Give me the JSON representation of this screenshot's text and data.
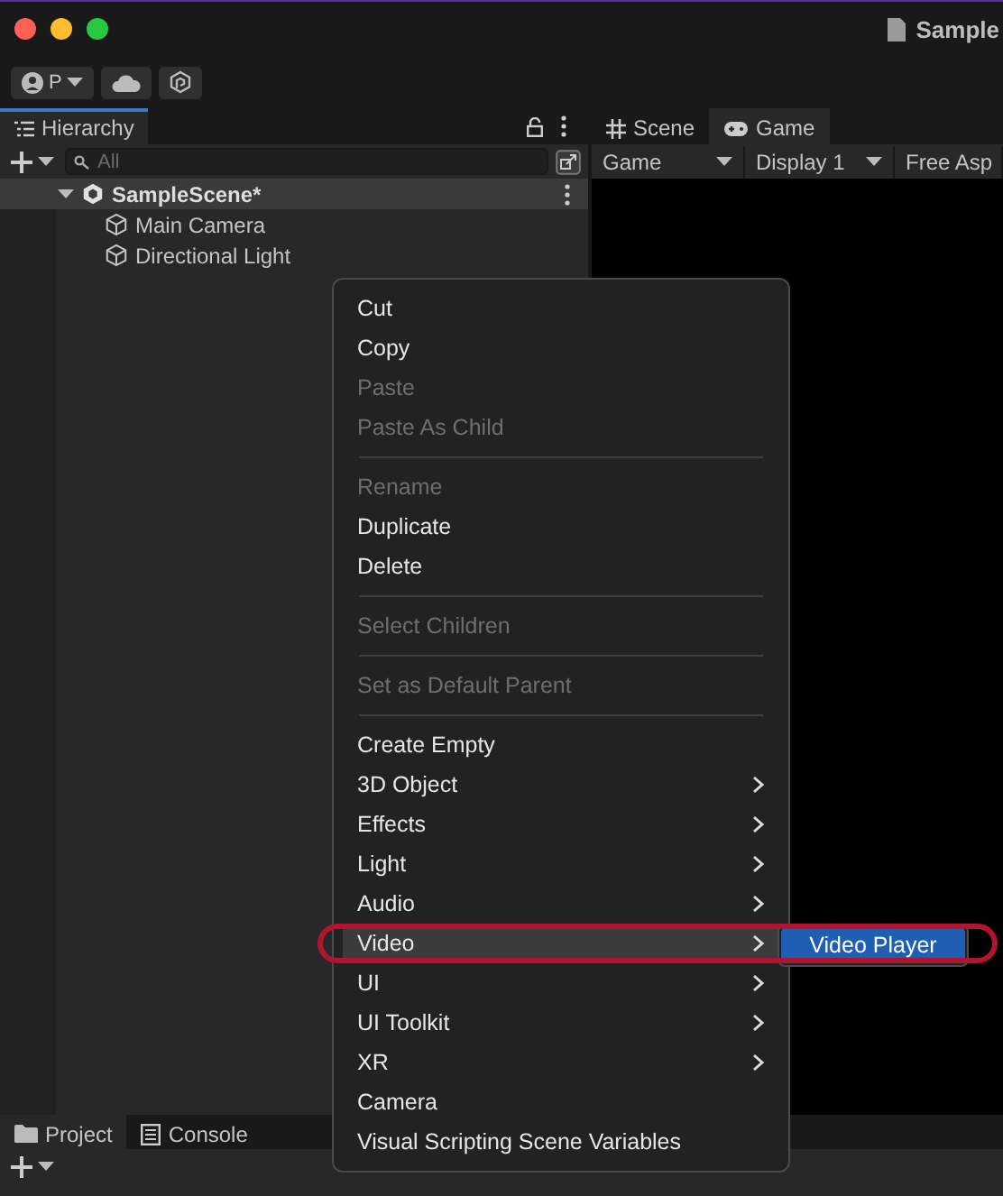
{
  "window": {
    "title": "Sample"
  },
  "toolbar": {
    "account": "P"
  },
  "hierarchy": {
    "tab": "Hierarchy",
    "search": {
      "placeholder": "All"
    },
    "tree": [
      {
        "label": "SampleScene*",
        "kind": "scene",
        "expanded": true,
        "selected": true,
        "children": [
          {
            "label": "Main Camera",
            "kind": "object",
            "selected": false
          },
          {
            "label": "Directional Light",
            "kind": "object",
            "selected": false
          }
        ]
      }
    ]
  },
  "view_tabs": [
    {
      "label": "Scene",
      "kind": "scene",
      "selected": false
    },
    {
      "label": "Game",
      "kind": "game",
      "selected": true
    }
  ],
  "game_toolbar": [
    "Game",
    "Display 1",
    "Free Asp"
  ],
  "bottom_tabs": [
    {
      "label": "Project",
      "kind": "folder",
      "selected": true
    },
    {
      "label": "Console",
      "kind": "console",
      "selected": false
    }
  ],
  "context_menu": {
    "items": [
      {
        "kind": "item",
        "label": "Cut",
        "disabled": false,
        "submenu": false,
        "selected": false
      },
      {
        "kind": "item",
        "label": "Copy",
        "disabled": false,
        "submenu": false,
        "selected": false
      },
      {
        "kind": "item",
        "label": "Paste",
        "disabled": true,
        "submenu": false,
        "selected": false
      },
      {
        "kind": "item",
        "label": "Paste As Child",
        "disabled": true,
        "submenu": false,
        "selected": false
      },
      {
        "kind": "separator"
      },
      {
        "kind": "item",
        "label": "Rename",
        "disabled": true,
        "submenu": false,
        "selected": false
      },
      {
        "kind": "item",
        "label": "Duplicate",
        "disabled": false,
        "submenu": false,
        "selected": false
      },
      {
        "kind": "item",
        "label": "Delete",
        "disabled": false,
        "submenu": false,
        "selected": false
      },
      {
        "kind": "separator"
      },
      {
        "kind": "item",
        "label": "Select Children",
        "disabled": true,
        "submenu": false,
        "selected": false
      },
      {
        "kind": "separator"
      },
      {
        "kind": "item",
        "label": "Set as Default Parent",
        "disabled": true,
        "submenu": false,
        "selected": false
      },
      {
        "kind": "separator"
      },
      {
        "kind": "item",
        "label": "Create Empty",
        "disabled": false,
        "submenu": false,
        "selected": false
      },
      {
        "kind": "item",
        "label": "3D Object",
        "disabled": false,
        "submenu": true,
        "selected": false
      },
      {
        "kind": "item",
        "label": "Effects",
        "disabled": false,
        "submenu": true,
        "selected": false
      },
      {
        "kind": "item",
        "label": "Light",
        "disabled": false,
        "submenu": true,
        "selected": false
      },
      {
        "kind": "item",
        "label": "Audio",
        "disabled": false,
        "submenu": true,
        "selected": false
      },
      {
        "kind": "item",
        "label": "Video",
        "disabled": false,
        "submenu": true,
        "selected": true
      },
      {
        "kind": "item",
        "label": "UI",
        "disabled": false,
        "submenu": true,
        "selected": false
      },
      {
        "kind": "item",
        "label": "UI Toolkit",
        "disabled": false,
        "submenu": true,
        "selected": false
      },
      {
        "kind": "item",
        "label": "XR",
        "disabled": false,
        "submenu": true,
        "selected": false
      },
      {
        "kind": "item",
        "label": "Camera",
        "disabled": false,
        "submenu": false,
        "selected": false
      },
      {
        "kind": "item",
        "label": "Visual Scripting Scene Variables",
        "disabled": false,
        "submenu": false,
        "selected": false
      }
    ],
    "submenu": [
      {
        "label": "Video Player",
        "selected": true
      }
    ]
  },
  "highlight": {
    "visible": true
  }
}
